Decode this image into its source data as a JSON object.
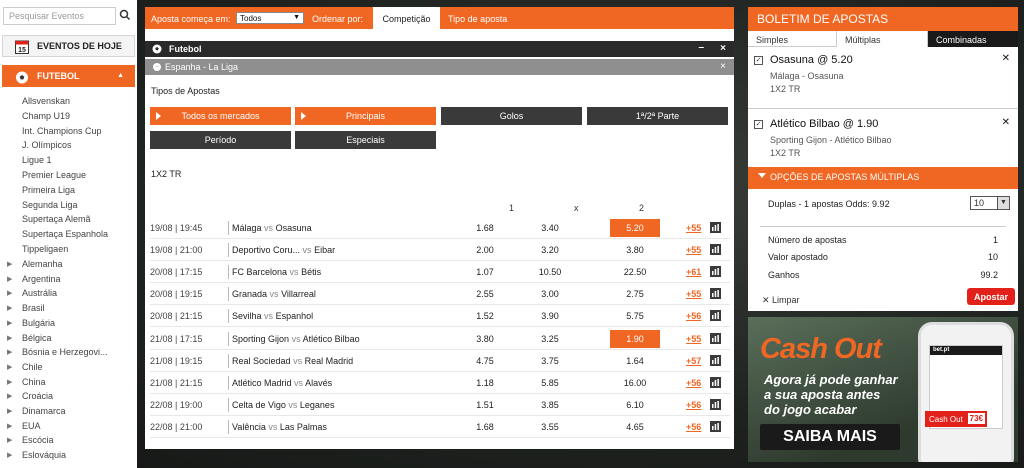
{
  "sidebar": {
    "search_placeholder": "Pesquisar Eventos",
    "today_label": "EVENTOS DE HOJE",
    "calendar_day": "15",
    "sport_label": "FUTEBOL",
    "leagues": [
      "Allsvenskan",
      "Champ U19",
      "Int. Champions Cup",
      "J. Olímpicos",
      "Ligue 1",
      "Premier League",
      "Primeira Liga",
      "Segunda Liga",
      "Supertaça Alemã",
      "Supertaça Espanhola",
      "Tippeligaen"
    ],
    "countries": [
      "Alemanha",
      "Argentina",
      "Austrália",
      "Brasil",
      "Bulgária",
      "Bélgica",
      "Bósnia e Herzegovi...",
      "Chile",
      "China",
      "Croácia",
      "Dinamarca",
      "EUA",
      "Escócia",
      "Eslováquia"
    ]
  },
  "topbar": {
    "start_label": "Aposta começa em:",
    "start_value": "Todos",
    "order_label": "Ordenar por:",
    "tab_competition": "Competição",
    "tab_type": "Tipo de aposta"
  },
  "sportbar": {
    "label": "Futebol",
    "min": "–",
    "close": "×"
  },
  "leaguebar": {
    "label": "Espanha - La Liga",
    "close": "×"
  },
  "markets": {
    "title": "Tipos de Apostas",
    "buttons": [
      "Todos os mercados",
      "Principais",
      "Golos",
      "1ª/2ª Parte",
      "Período",
      "Especiais"
    ]
  },
  "table": {
    "market_name": "1X2 TR",
    "headers": [
      "1",
      "x",
      "2"
    ],
    "rows": [
      {
        "date": "19/08 | 19:45",
        "home": "Málaga",
        "away": "Osasuna",
        "o1": "1.68",
        "ox": "3.40",
        "o2": "5.20",
        "more": "+55"
      },
      {
        "date": "19/08 | 21:00",
        "home": "Deportivo Coru...",
        "away": "Eibar",
        "o1": "2.00",
        "ox": "3.20",
        "o2": "3.80",
        "more": "+55"
      },
      {
        "date": "20/08 | 17:15",
        "home": "FC Barcelona",
        "away": "Bétis",
        "o1": "1.07",
        "ox": "10.50",
        "o2": "22.50",
        "more": "+61"
      },
      {
        "date": "20/08 | 19:15",
        "home": "Granada",
        "away": "Villarreal",
        "o1": "2.55",
        "ox": "3.00",
        "o2": "2.75",
        "more": "+55"
      },
      {
        "date": "20/08 | 21:15",
        "home": "Sevilha",
        "away": "Espanhol",
        "o1": "1.52",
        "ox": "3.90",
        "o2": "5.75",
        "more": "+56"
      },
      {
        "date": "21/08 | 17:15",
        "home": "Sporting Gijon",
        "away": "Atlético Bilbao",
        "o1": "3.80",
        "ox": "3.25",
        "o2": "1.90",
        "more": "+55"
      },
      {
        "date": "21/08 | 19:15",
        "home": "Real Sociedad",
        "away": "Real Madrid",
        "o1": "4.75",
        "ox": "3.75",
        "o2": "1.64",
        "more": "+57"
      },
      {
        "date": "21/08 | 21:15",
        "home": "Atlético Madrid",
        "away": "Alavés",
        "o1": "1.18",
        "ox": "5.85",
        "o2": "16.00",
        "more": "+56"
      },
      {
        "date": "22/08 | 19:00",
        "home": "Celta de Vigo",
        "away": "Leganes",
        "o1": "1.51",
        "ox": "3.85",
        "o2": "6.10",
        "more": "+56"
      },
      {
        "date": "22/08 | 21:00",
        "home": "Valência",
        "away": "Las Palmas",
        "o1": "1.68",
        "ox": "3.55",
        "o2": "4.65",
        "more": "+56"
      }
    ],
    "vs": "vs"
  },
  "betslip": {
    "title": "BOLETIM DE APOSTAS",
    "tabs": [
      "Simples",
      "Múltiplas",
      "Combinadas"
    ],
    "bets": [
      {
        "selection": "Osasuna  @ 5.20",
        "match": "Málaga - Osasuna",
        "market": "1X2 TR"
      },
      {
        "selection": "Atlético Bilbao  @ 1.90",
        "match": "Sporting Gijon - Atlético Bilbao",
        "market": "1X2 TR"
      }
    ],
    "options_label": "OPÇÕES DE APOSTAS MÚLTIPLAS",
    "duplas_label": "Duplas - 1 apostas Odds: 9.92",
    "stake_value": "10",
    "summary": [
      {
        "label": "Número de apostas",
        "value": "1"
      },
      {
        "label": "Valor apostado",
        "value": "10"
      },
      {
        "label": "Ganhos",
        "value": "99.2"
      }
    ],
    "clear_label": "Limpar",
    "place_label": "Apostar"
  },
  "promo": {
    "title": "Cash Out",
    "line1": "Agora já pode ganhar",
    "line2": "a sua aposta antes",
    "line3": "do jogo acabar",
    "cta": "SAIBA MAIS",
    "phone_logo": "bet.pt",
    "phone_button": "Cash Out",
    "phone_value": "73€"
  },
  "colors": {
    "accent": "#f06623",
    "dark": "#2a2a2a",
    "red": "#e2221a"
  }
}
